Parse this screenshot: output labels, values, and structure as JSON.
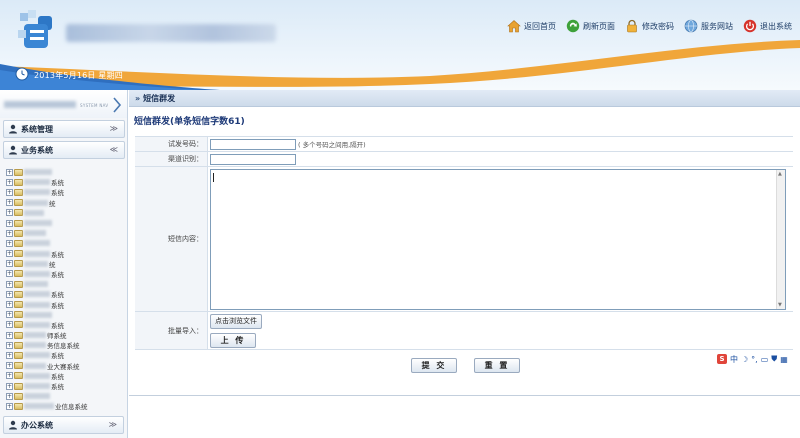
{
  "header": {
    "date_text": "2013年5月16日   星期四",
    "nav": [
      {
        "label": "返回首页",
        "icon": "home-icon"
      },
      {
        "label": "刷新页面",
        "icon": "refresh-icon"
      },
      {
        "label": "修改密码",
        "icon": "lock-icon"
      },
      {
        "label": "服务网站",
        "icon": "globe-icon"
      },
      {
        "label": "退出系统",
        "icon": "power-icon"
      }
    ]
  },
  "sidebar": {
    "tiny_text": "SYSTEM NAV",
    "groups": {
      "system": "系统管理",
      "business": "业务系统",
      "office": "办公系统"
    },
    "tree": [
      {
        "text": "",
        "mask": 28
      },
      {
        "text": "系统",
        "mask": 26
      },
      {
        "text": "系统",
        "mask": 26
      },
      {
        "text": "统",
        "mask": 24
      },
      {
        "text": "",
        "mask": 20
      },
      {
        "text": "",
        "mask": 28
      },
      {
        "text": "",
        "mask": 22
      },
      {
        "text": "",
        "mask": 26
      },
      {
        "text": "系统",
        "mask": 26
      },
      {
        "text": "统",
        "mask": 24
      },
      {
        "text": "系统",
        "mask": 26
      },
      {
        "text": "",
        "mask": 24
      },
      {
        "text": "系统",
        "mask": 26
      },
      {
        "text": "系统",
        "mask": 26
      },
      {
        "text": "",
        "mask": 28
      },
      {
        "text": "系统",
        "mask": 26
      },
      {
        "text": "师系统",
        "mask": 22
      },
      {
        "text": "务信息系统",
        "mask": 22
      },
      {
        "text": "系统",
        "mask": 26
      },
      {
        "text": "业大赛系统",
        "mask": 22
      },
      {
        "text": "系统",
        "mask": 26
      },
      {
        "text": "系统",
        "mask": 26
      },
      {
        "text": "",
        "mask": 26
      },
      {
        "text": "业信息系统",
        "mask": 30
      }
    ]
  },
  "main": {
    "breadcrumb_arrow": "»",
    "breadcrumb": "短信群发",
    "title": "短信群发(单条短信字数61)",
    "form": {
      "test_number_label": "试发号码：",
      "test_number_hint": "( 多个号码之间用,隔开)",
      "channel_label": "渠道识别：",
      "content_label": "短信内容：",
      "import_label": "批量导入：",
      "browse_label": "点击浏览文件",
      "upload_label": "上 传"
    },
    "submit_label": "提 交",
    "reset_label": "重 置"
  },
  "imebar": {
    "s": "S",
    "zh": "中",
    "moon": "☽",
    "dot": "°,",
    "kbd": "▭",
    "shirt": "⛊",
    "grid": "▦"
  }
}
